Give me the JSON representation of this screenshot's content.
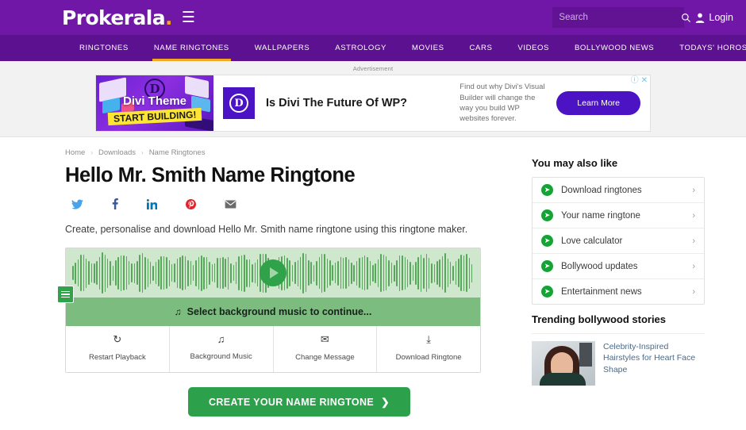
{
  "header": {
    "logo_text": "Prokerala",
    "menu_icon": "hamburger-icon",
    "search_placeholder": "Search",
    "search_value": "",
    "login_label": "Login"
  },
  "nav": {
    "items": [
      {
        "label": "RINGTONES",
        "active": false
      },
      {
        "label": "NAME RINGTONES",
        "active": true
      },
      {
        "label": "WALLPAPERS",
        "active": false
      },
      {
        "label": "ASTROLOGY",
        "active": false
      },
      {
        "label": "MOVIES",
        "active": false
      },
      {
        "label": "CARS",
        "active": false
      },
      {
        "label": "VIDEOS",
        "active": false
      },
      {
        "label": "BOLLYWOOD NEWS",
        "active": false
      },
      {
        "label": "TODAYS' HOROSCOPE",
        "active": false
      }
    ]
  },
  "ad": {
    "label": "Advertisement",
    "thumb_title": "Divi Theme",
    "thumb_sub": "START BUILDING!",
    "thumb_logo": "D",
    "logo_letter": "D",
    "headline": "Is Divi The Future Of WP?",
    "description": "Find out why Divi's Visual Builder will change the way you build WP websites forever.",
    "cta": "Learn More",
    "info_icon": "adchoices-info-icon",
    "close_icon": "close-icon"
  },
  "breadcrumb": {
    "items": [
      "Home",
      "Downloads",
      "Name Ringtones"
    ],
    "separator": "›"
  },
  "main": {
    "title": "Hello Mr. Smith Name Ringtone",
    "lede": "Create, personalise and download Hello Mr. Smith name ringtone using this ringtone maker.",
    "share": [
      {
        "name": "twitter-icon",
        "color": "#4aa3e8"
      },
      {
        "name": "facebook-icon",
        "color": "#3b5998"
      },
      {
        "name": "linkedin-icon",
        "color": "#0077b5"
      },
      {
        "name": "pinterest-icon",
        "color": "#e0242a"
      },
      {
        "name": "email-icon",
        "color": "#6b6b6b"
      }
    ],
    "player": {
      "play_icon": "play-icon",
      "handle_icon": "menu-handle-icon",
      "status_text": "Select background music to continue...",
      "status_icon": "music-note-icon",
      "actions": [
        {
          "icon": "restart-icon",
          "glyph": "↻",
          "label": "Restart Playback"
        },
        {
          "icon": "music-note-icon",
          "glyph": "♫",
          "label": "Background Music"
        },
        {
          "icon": "envelope-icon",
          "glyph": "✉",
          "label": "Change Message"
        },
        {
          "icon": "download-icon",
          "glyph": "⤓",
          "label": "Download Ringtone"
        }
      ]
    },
    "cta_label": "CREATE YOUR NAME RINGTONE",
    "cta_icon": "chevron-right-icon"
  },
  "sidebar": {
    "also_like_title": "You may also like",
    "links": [
      {
        "label": "Download ringtones"
      },
      {
        "label": "Your name ringtone"
      },
      {
        "label": "Love calculator"
      },
      {
        "label": "Bollywood updates"
      },
      {
        "label": "Entertainment news"
      }
    ],
    "link_icon": "arrow-right-circle-icon",
    "chevron": "›",
    "trending_title": "Trending bollywood stories",
    "trending": [
      {
        "headline": "Celebrity-Inspired Hairstyles for Heart Face Shape",
        "thumb": "woman-portrait-thumbnail"
      }
    ]
  },
  "colors": {
    "brand_purple": "#7117a8",
    "nav_purple": "#5b1190",
    "accent_orange": "#f5a623",
    "green": "#2fa24a",
    "green_bar": "#7cbd7f",
    "wave_bg": "#cfe8cd"
  }
}
